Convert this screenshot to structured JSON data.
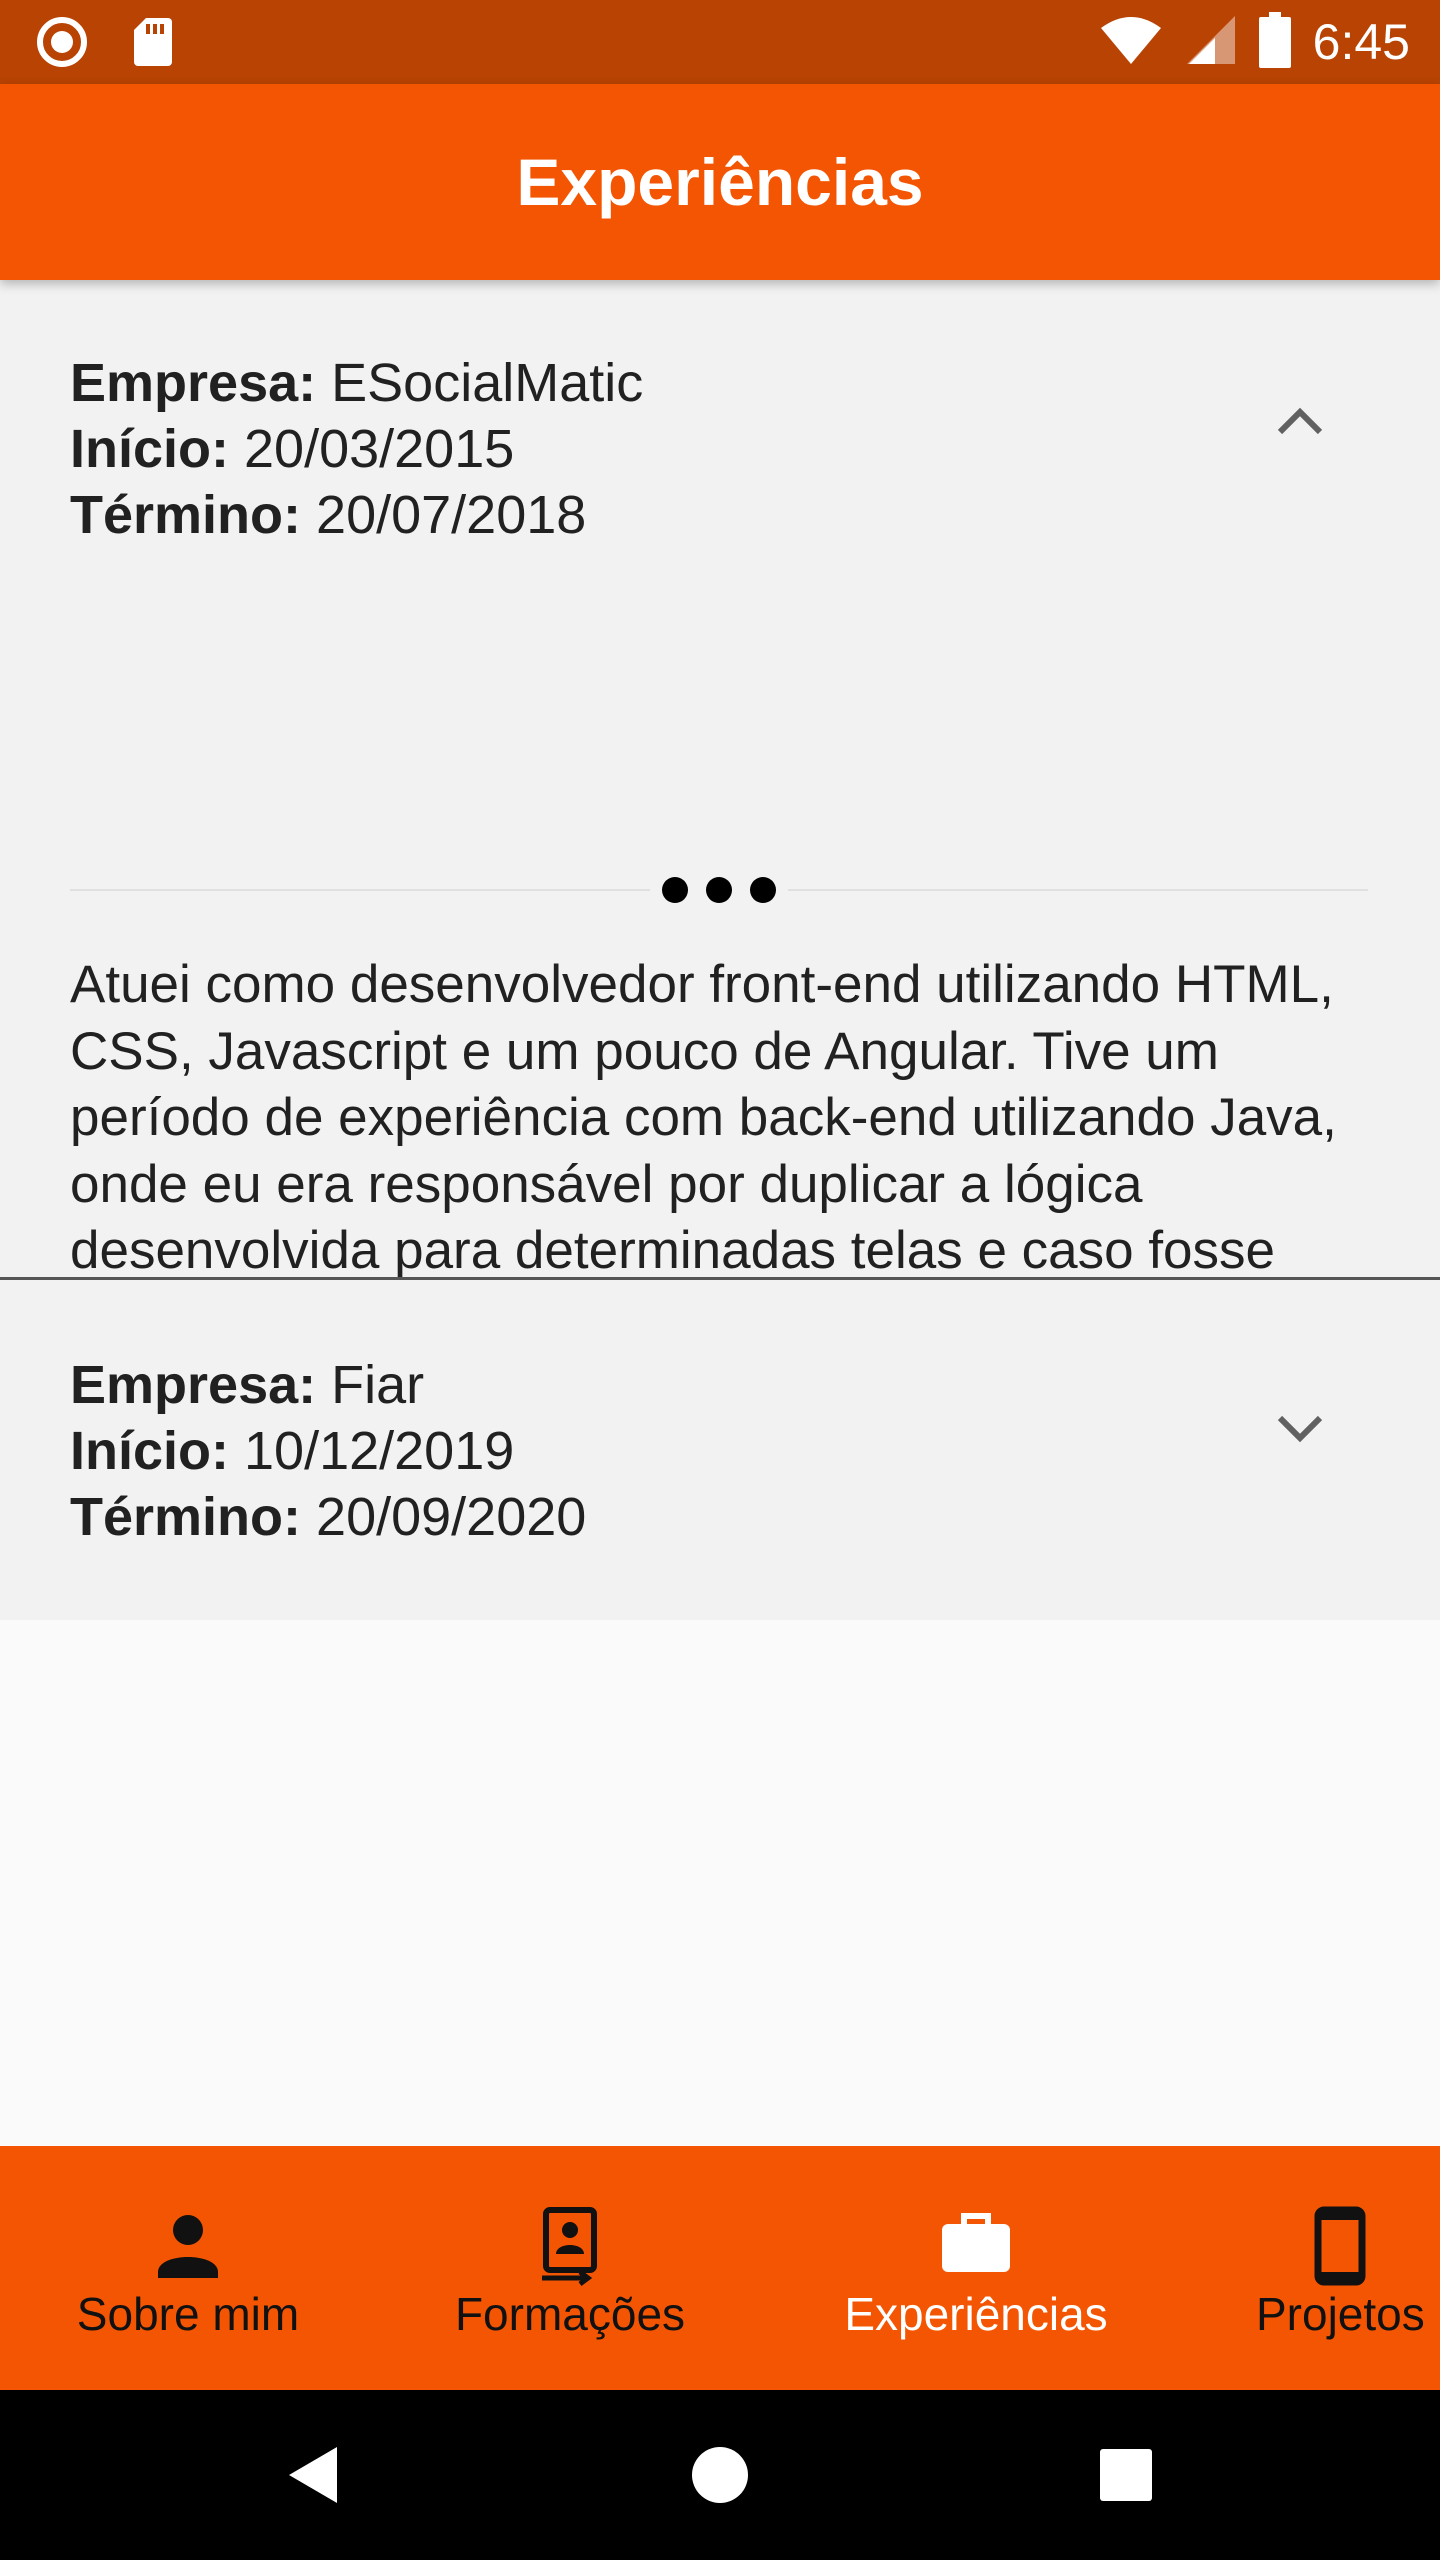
{
  "status_bar": {
    "time": "6:45",
    "left_icons": [
      "record-icon",
      "sd-card-icon"
    ],
    "right_icons": [
      "wifi-icon",
      "signal-icon",
      "battery-icon"
    ]
  },
  "app_bar": {
    "title": "Experiências"
  },
  "experiences": [
    {
      "company_label": "Empresa:",
      "company": "ESocialMatic",
      "start_label": "Início:",
      "start": "20/03/2015",
      "end_label": "Término:",
      "end": "20/07/2018",
      "expanded": true,
      "description": "Atuei como desenvolvedor front-end utilizando HTML, CSS, Javascript e um pouco de Angular. Tive um período de experiência com back-end utilizando Java, onde eu era responsável por duplicar a lógica desenvolvida para determinadas telas e caso fosse preciso, alteraria a lógica para suprir determinada situação, além de atuar como Tester focado mais na parte técnica"
    },
    {
      "company_label": "Empresa:",
      "company": "Fiar",
      "start_label": "Início:",
      "start": "10/12/2019",
      "end_label": "Término:",
      "end": "20/09/2020",
      "expanded": false
    }
  ],
  "bottom_nav": {
    "items": [
      {
        "label": "Sobre mim",
        "icon": "person-icon",
        "active": false
      },
      {
        "label": "Formações",
        "icon": "contact-book-icon",
        "active": false
      },
      {
        "label": "Experiências",
        "icon": "briefcase-icon",
        "active": true
      },
      {
        "label": "Projetos",
        "icon": "smartphone-icon",
        "active": false
      }
    ]
  },
  "system_nav": [
    "back-icon",
    "home-icon",
    "recents-icon"
  ],
  "colors": {
    "status_bar": "#b84303",
    "primary": "#f35503",
    "panel_bg": "#f2f2f2",
    "page_bg": "#fafafa"
  }
}
